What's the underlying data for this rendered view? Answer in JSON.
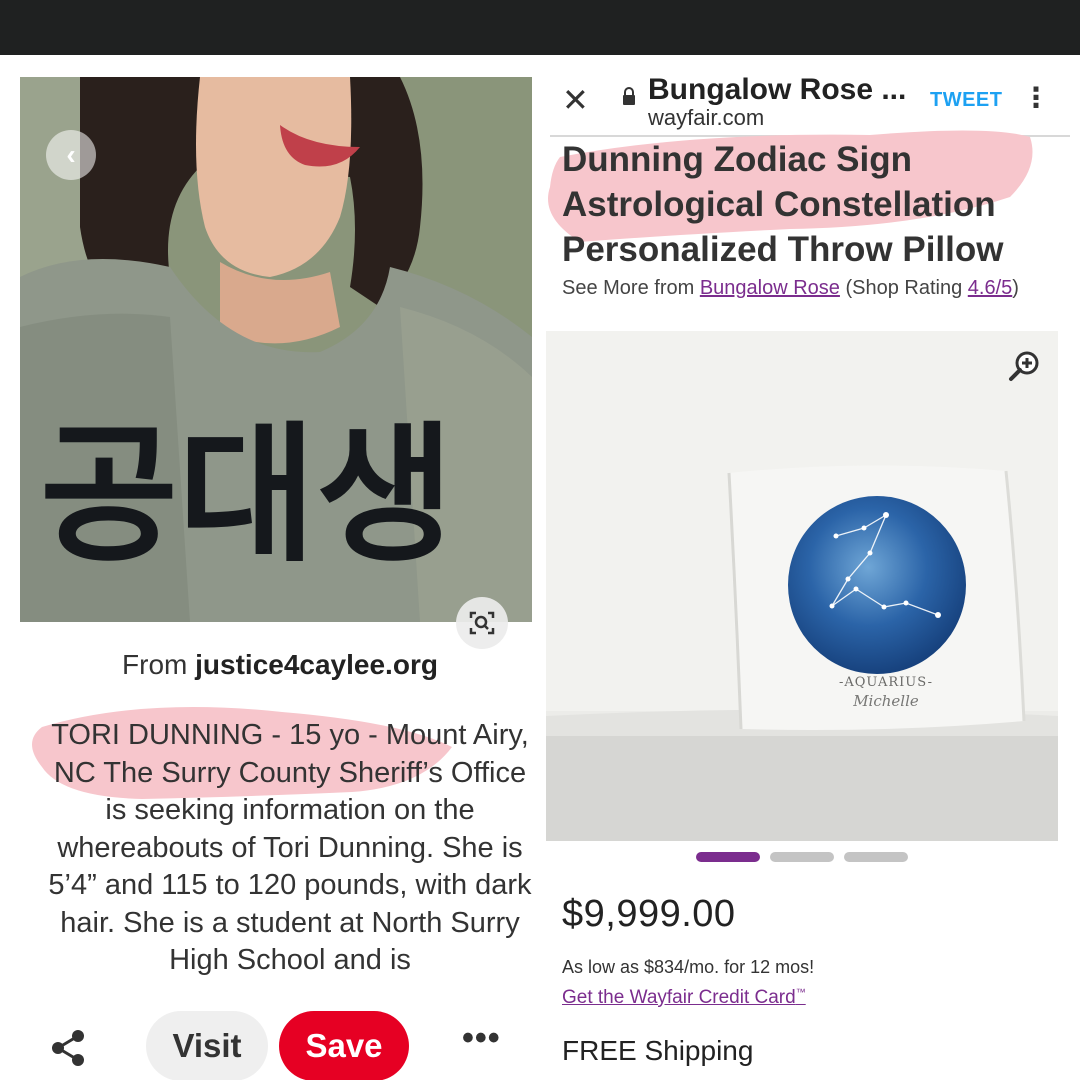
{
  "left_pane": {
    "from_prefix": "From ",
    "from_source": "justice4caylee.org",
    "description": "TORI DUNNING - 15 yo - Mount Airy, NC The Surry County Sheriff’s Office is seeking information on the whereabouts of Tori Dunning. She is 5’4” and 115 to 120 pounds, with dark hair. She is a student at North Surry High School and is",
    "photo_shirt_text": "공대생",
    "back_icon": "chevron-left-icon",
    "lens_icon": "visual-search-icon",
    "actions": {
      "share_icon": "share-icon",
      "visit_label": "Visit",
      "save_label": "Save",
      "more_label": "•••"
    }
  },
  "right_pane": {
    "header": {
      "close_label": "✕",
      "site_title": "Bungalow Rose ...",
      "url": "wayfair.com",
      "tweet_label": "TWEET",
      "menu_label": "⋮"
    },
    "product": {
      "title": "Dunning Zodiac Sign Astrological Constellation Personalized Throw Pillow",
      "see_more_prefix": "See More from ",
      "shop_name": "Bungalow Rose",
      "rating_prefix": " (Shop Rating ",
      "rating_value": "4.6/5",
      "rating_suffix": ")",
      "pillow_sign": "-AQUARIUS-",
      "pillow_name": "Michelle",
      "price": "$9,999.00",
      "financing": "As low as $834/mo. for 12 mos!",
      "credit_link": "Get the Wayfair Credit Card",
      "credit_mark": "™",
      "shipping": "FREE Shipping"
    },
    "carousel": {
      "active_index": 0,
      "count": 3
    }
  },
  "colors": {
    "top_bar": "#1f2121",
    "save_red": "#e60023",
    "wayfair_purple": "#7b2d8e",
    "tweet_blue": "#1da1f2",
    "highlight_pink": "#f7c6cc"
  }
}
